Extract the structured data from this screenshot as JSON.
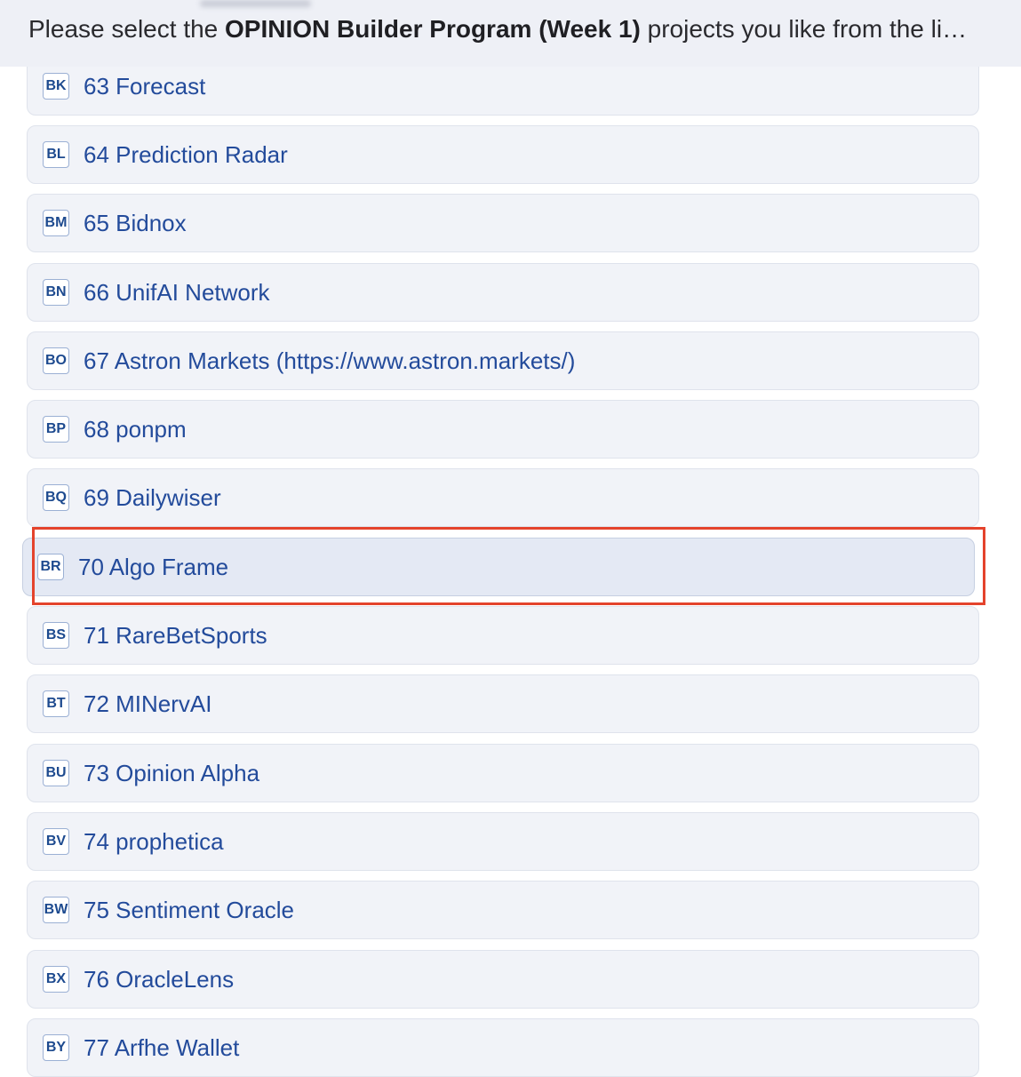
{
  "question": {
    "prefix": "Please select the ",
    "bold": "OPINION Builder Program (Week 1)",
    "suffix": " projects you like from the li…"
  },
  "options": [
    {
      "key": "BK",
      "label": "63 Forecast"
    },
    {
      "key": "BL",
      "label": "64 Prediction Radar"
    },
    {
      "key": "BM",
      "label": "65 Bidnox"
    },
    {
      "key": "BN",
      "label": "66 UnifAI Network"
    },
    {
      "key": "BO",
      "label": "67 Astron Markets (https://www.astron.markets/)"
    },
    {
      "key": "BP",
      "label": "68 ponpm"
    },
    {
      "key": "BQ",
      "label": "69 Dailywiser"
    },
    {
      "key": "BR",
      "label": "70 Algo Frame"
    },
    {
      "key": "BS",
      "label": "71 RareBetSports"
    },
    {
      "key": "BT",
      "label": "72 MINervAI"
    },
    {
      "key": "BU",
      "label": "73 Opinion Alpha"
    },
    {
      "key": "BV",
      "label": "74 prophetica"
    },
    {
      "key": "BW",
      "label": "75 Sentiment Oracle"
    },
    {
      "key": "BX",
      "label": "76 OracleLens"
    },
    {
      "key": "BY",
      "label": "77 Arfhe Wallet"
    }
  ],
  "colors": {
    "highlight": "#e4432c",
    "option_text": "#234b9b",
    "option_bg": "#f1f3f8",
    "hover_bg": "#e4e9f4"
  }
}
